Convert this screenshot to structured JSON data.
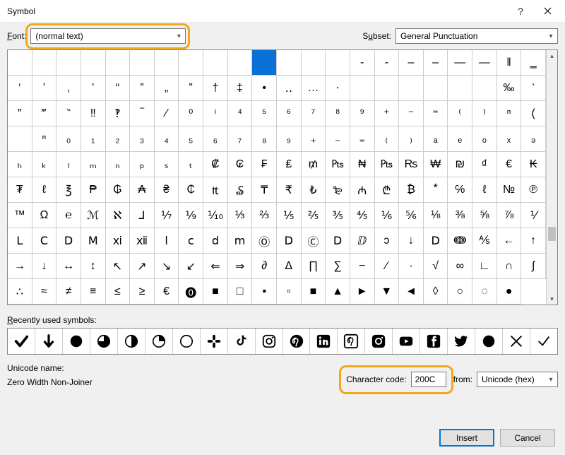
{
  "window": {
    "title": "Symbol"
  },
  "labels": {
    "font": "Font:",
    "subset": "Subset:",
    "recent": "Recently used symbols:",
    "unicode_name": "Unicode name:",
    "char_code": "Character code:",
    "from": "from:"
  },
  "font": {
    "value": "(normal text)"
  },
  "subset": {
    "value": "General Punctuation"
  },
  "char_code": {
    "value": "200C"
  },
  "from": {
    "value": "Unicode (hex)"
  },
  "unicode_name_value": "Zero Width Non-Joiner",
  "buttons": {
    "insert": "Insert",
    "cancel": "Cancel"
  },
  "grid": {
    "rows": [
      [
        "",
        "",
        "",
        "",
        "",
        "",
        "",
        "",
        "",
        "",
        "",
        "",
        "",
        "",
        "‐",
        "‑",
        "‒",
        "–",
        "—",
        "―",
        "‖",
        "‗"
      ],
      [
        "‘",
        "’",
        "‚",
        "‛",
        "“",
        "”",
        "„",
        "‟",
        "†",
        "‡",
        "•",
        "‥",
        "…",
        "‧",
        "",
        "",
        "",
        "",
        "",
        "",
        "‰",
        "‵"
      ],
      [
        "″",
        "‴",
        "‶",
        "‼",
        "‽",
        "‾",
        "⁄",
        "⁰",
        "ⁱ",
        "⁴",
        "⁵",
        "⁶",
        "⁷",
        "⁸",
        "⁹",
        "⁺",
        "⁻",
        "⁼",
        "⁽",
        "⁾",
        "ⁿ",
        "("
      ],
      [
        "⁯",
        "ⁿ",
        "₀",
        "₁",
        "₂",
        "₃",
        "₄",
        "₅",
        "₆",
        "₇",
        "₈",
        "₉",
        "₊",
        "₋",
        "₌",
        "₍",
        "₎",
        "ₐ",
        "ₑ",
        "ₒ",
        "ₓ",
        "ₔ"
      ],
      [
        "ₕ",
        "ₖ",
        "ₗ",
        "ₘ",
        "ₙ",
        "ₚ",
        "ₛ",
        "ₜ",
        "₡",
        "₢",
        "₣",
        "₤",
        "₥",
        "₧",
        "₦",
        "₧",
        "₨",
        "₩",
        "₪",
        "₫",
        "€",
        "₭"
      ],
      [
        "₮",
        "ℓ",
        "℥",
        "₱",
        "₲",
        "₳",
        "₴",
        "₵",
        "₶",
        "₷",
        "₸",
        "₹",
        "₺",
        "₻",
        "₼",
        "₾",
        "₿",
        "⃰",
        "℅",
        "ℓ",
        "№"
      ],
      [
        "℗",
        "™",
        "Ω",
        "℮",
        "ℳ",
        "ℵ",
        "⅃",
        "⅐",
        "⅑",
        "⅒",
        "⅓",
        "⅔",
        "⅕",
        "⅖",
        "⅗",
        "⅘",
        "⅙",
        "⅚",
        "⅛",
        "⅜",
        "⅝",
        "⅞"
      ],
      [
        "⅟",
        "Ⅼ",
        "Ⅽ",
        "Ⅾ",
        "Ⅿ",
        "ⅺ",
        "ⅻ",
        "ⅼ",
        "ⅽ",
        "ⅾ",
        "ⅿ",
        "Ⓞ",
        "Ⅾ",
        "Ⓒ",
        "Ⅾ",
        "ⅅ",
        "ↄ",
        "↓",
        "Ⅾ",
        "ↈ",
        "⅍",
        "←"
      ],
      [
        "↑",
        "→",
        "↓",
        "↔",
        "↕",
        "↖",
        "↗",
        "↘",
        "↙",
        "⇐",
        "⇒",
        "∂",
        "∆",
        "∏",
        "∑",
        "−",
        "⁄",
        "∙",
        "√",
        "∞",
        "∟",
        "∩"
      ],
      [
        "∫",
        "∴",
        "≈",
        "≠",
        "≡",
        "≤",
        "≥",
        "€",
        "⓿",
        "■",
        "□",
        "▪",
        "▫",
        "■",
        "▲",
        "►",
        "▼",
        "◄",
        "◊",
        "○",
        "◌",
        "●"
      ]
    ],
    "selected": {
      "row": 0,
      "col": 10
    }
  },
  "recent": [
    "check",
    "down-arrow",
    "circle-full",
    "circle-qhr",
    "circle-half",
    "circle-qtr",
    "circle-empty",
    "slack",
    "tiktok",
    "instagram",
    "pinterest",
    "linkedin",
    "pinterest2",
    "ig2",
    "youtube",
    "facebook",
    "twitter",
    "circle-full2",
    "x-mark",
    "tick-thin"
  ]
}
